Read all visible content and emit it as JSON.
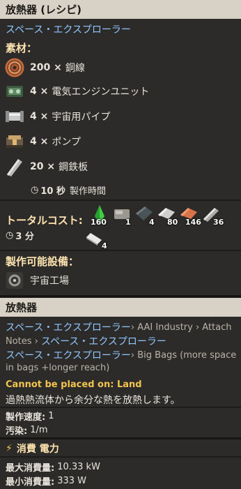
{
  "recipe": {
    "title": "放熱器 (レシピ)",
    "source": "スペース・エクスプローラー",
    "ingredients_title": "素材：",
    "ingredients": [
      {
        "amount": "200 ×",
        "name": "銅線",
        "icon": "copper-cable-icon"
      },
      {
        "amount": "4 ×",
        "name": "電気エンジンユニット",
        "icon": "engine-unit-icon"
      },
      {
        "amount": "4 ×",
        "name": "宇宙用パイプ",
        "icon": "pipe-icon"
      },
      {
        "amount": "4 ×",
        "name": "ポンプ",
        "icon": "pump-icon"
      },
      {
        "amount": "20 ×",
        "name": "鋼鉄板",
        "icon": "steel-plate-icon"
      }
    ],
    "time_value": "10 秒",
    "time_label": "製作時間",
    "total_cost_label": "トータルコスト:",
    "total_time": "3 分",
    "total_costs": [
      {
        "icon": "green-crystal-icon",
        "value": "160"
      },
      {
        "icon": "stone-icon",
        "value": "1"
      },
      {
        "icon": "dark-plate-icon",
        "value": "4"
      },
      {
        "icon": "iron-ore-icon",
        "value": "80"
      },
      {
        "icon": "copper-ore-icon",
        "value": "146"
      },
      {
        "icon": "steel-beam-icon",
        "value": "36"
      },
      {
        "icon": "white-plate-icon",
        "value": "4"
      }
    ],
    "made_in_title": "製作可能設備：",
    "made_in": "宇宙工場"
  },
  "entity": {
    "title": "放熱器",
    "mods_line1": {
      "a": "スペース・エクスプローラー",
      "b": " › AAI Industry › Attach"
    },
    "mods_line2": {
      "a": "Notes",
      "b": " › ",
      "c": "スペース・エクスプローラー"
    },
    "mods_line3": {
      "a": "スペース・エクスプローラー",
      "b": " › Big Bags (more space"
    },
    "mods_line4": "in bags +longer reach)",
    "warning": "Cannot be placed on: Land",
    "description": "過熱熱流体から余分な熱を放熱します。",
    "speed_label": "製作速度:",
    "speed_value": "1",
    "pollution_label": "汚染:",
    "pollution_value": "1/m"
  },
  "power": {
    "title": "消費 電力",
    "max_label": "最大消費量:",
    "max_value": "10.33 kW",
    "min_label": "最小消費量:",
    "min_value": "333 W"
  },
  "colors": {
    "header": "#d8d2c6",
    "link": "#8fc6ff",
    "section": "#ffe4b0",
    "warning": "#f3c54e"
  }
}
